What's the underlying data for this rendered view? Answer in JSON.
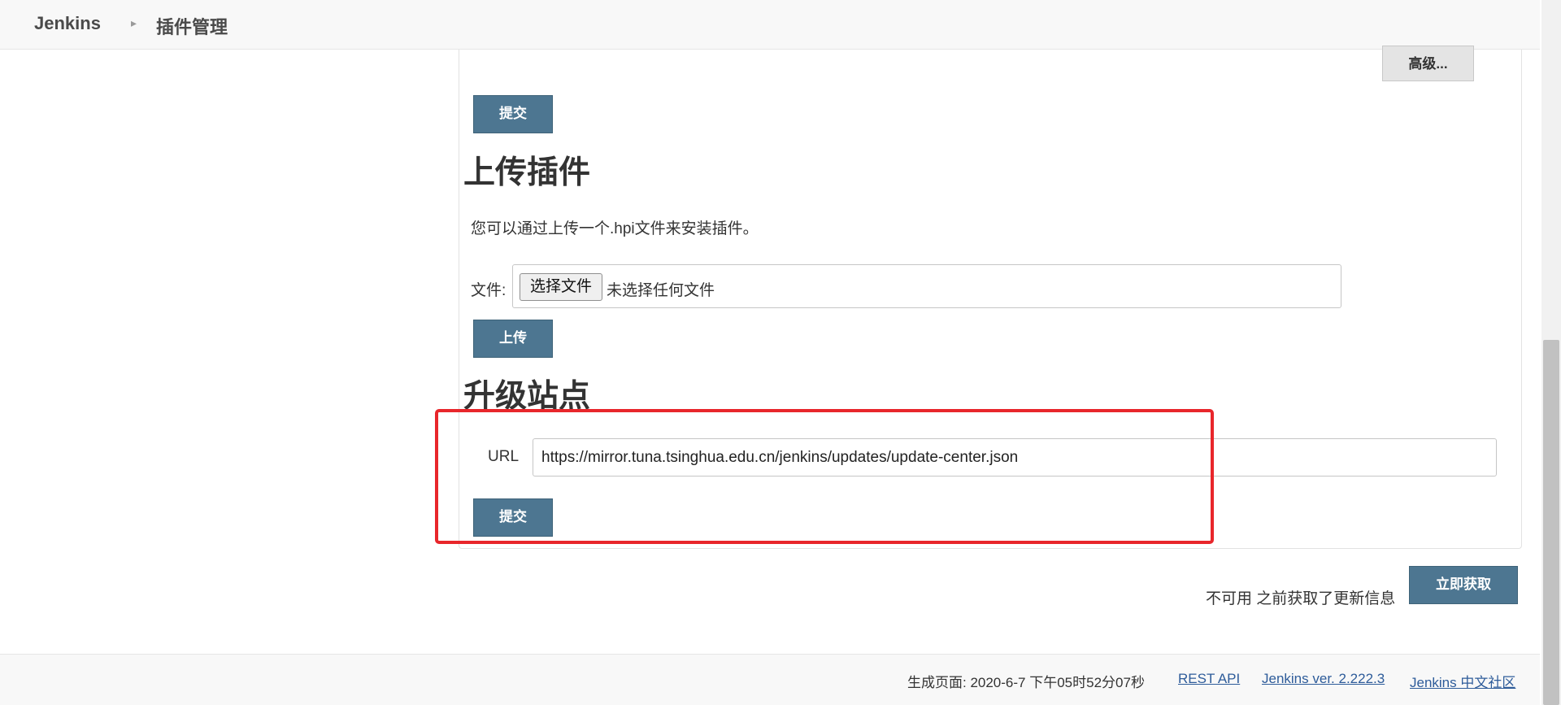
{
  "header": {
    "home": "Jenkins",
    "separator": "▸",
    "current": "插件管理"
  },
  "advanced": {
    "button_label": "高级..."
  },
  "advanced_submit": {
    "label": "提交"
  },
  "upload": {
    "title": "上传插件",
    "description": "您可以通过上传一个.hpi文件来安装插件。",
    "file_label": "文件:",
    "choose_file_label": "选择文件",
    "file_status": "未选择任何文件",
    "upload_button": "上传"
  },
  "update_site": {
    "title": "升级站点",
    "url_label": "URL",
    "url_value": "https://mirror.tuna.tsinghua.edu.cn/jenkins/updates/update-center.json",
    "submit_label": "提交"
  },
  "status": {
    "text": "不可用 之前获取了更新信息",
    "check_now_button": "立即获取"
  },
  "footer": {
    "generated": "生成页面: 2020-6-7 下午05时52分07秒",
    "rest_api": "REST API",
    "version": "Jenkins ver. 2.222.3",
    "community": "Jenkins 中文社区"
  },
  "colors": {
    "primary_button": "#4d7691",
    "highlight": "#e8262b",
    "link": "#2e5c9a"
  }
}
